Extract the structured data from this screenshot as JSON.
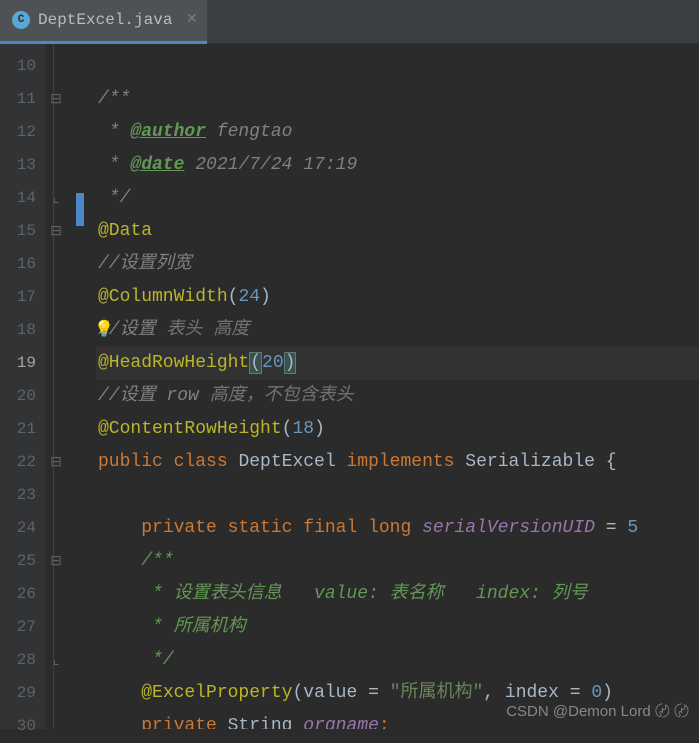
{
  "tab": {
    "label": "DeptExcel.java",
    "icon_letter": "C"
  },
  "gutter": {
    "start": 10,
    "end": 30,
    "active": 19
  },
  "code": {
    "l11_open": "/**",
    "l12_pre": " * ",
    "l12_tag": "@author",
    "l12_val": " fengtao",
    "l13_pre": " * ",
    "l13_tag": "@date",
    "l13_val": " 2021/7/24 17:19",
    "l14_close": " */",
    "l15_anno": "@Data",
    "l16_comment": "//设置列宽",
    "l17_anno": "@ColumnWidth",
    "l17_num": "24",
    "l18_c1": "//",
    "l18_c2": "设置 ",
    "l18_c3": "表头 高度",
    "l19_anno": "@HeadRowHeight",
    "l19_num": "20",
    "l20_c1": "//",
    "l20_c2": "设置 ",
    "l20_c3": "row ",
    "l20_c4": "高度，不包含表头",
    "l21_anno": "@ContentRowHeight",
    "l21_num": "18",
    "l22_public": "public ",
    "l22_class": "class ",
    "l22_name": "DeptExcel ",
    "l22_impl": "implements ",
    "l22_iface": "Serializable ",
    "l22_brace": "{",
    "l24_private": "private ",
    "l24_static": "static ",
    "l24_final": "final ",
    "l24_long": "long ",
    "l24_field": "serialVersionUID",
    "l24_eq": " = ",
    "l24_val": "5",
    "l25_open": "/**",
    "l26_txt": " * 设置表头信息   value: 表名称   index: 列号",
    "l27_txt": " * 所属机构",
    "l28_close": " */",
    "l29_anno": "@ExcelProperty",
    "l29_value": "value",
    "l29_str": "\"所属机构\"",
    "l29_index": "index",
    "l29_num": "0",
    "l30_private": "private ",
    "l30_type": "String ",
    "l30_field": "orgname",
    "l30_semi": ";"
  },
  "watermark": "CSDN @Demon Lord 〄 〄"
}
